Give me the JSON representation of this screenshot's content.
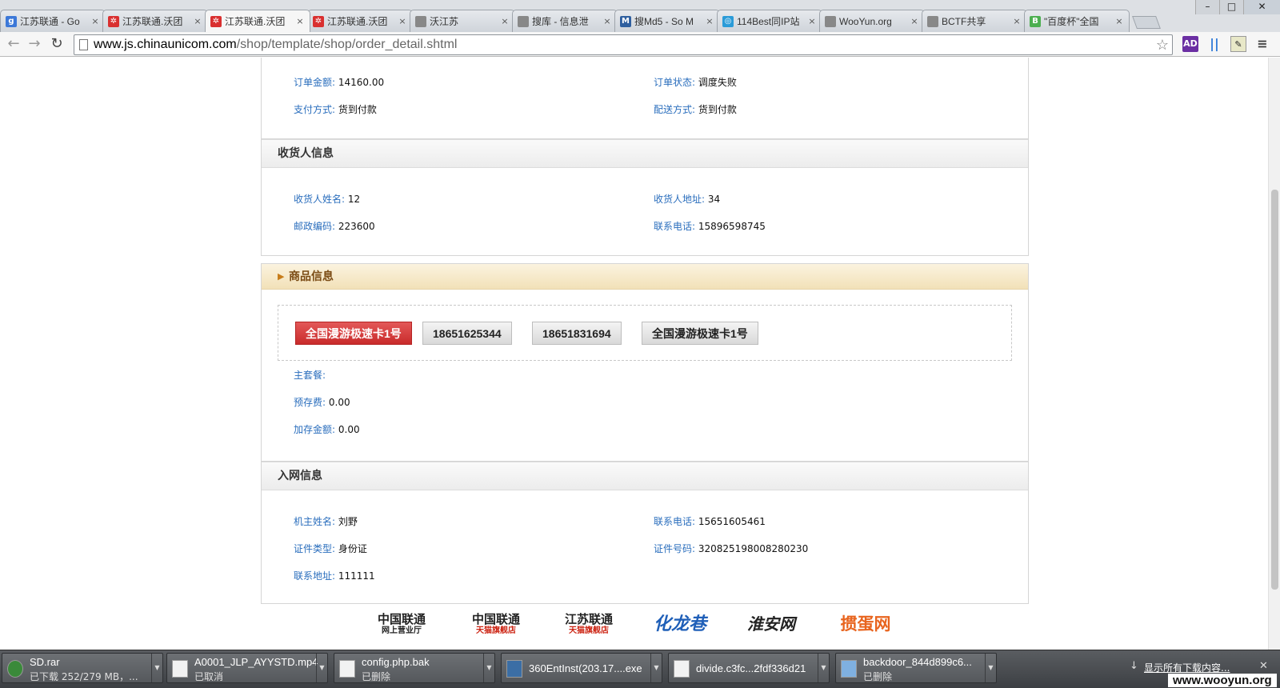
{
  "browser": {
    "tabs": [
      {
        "title": "江苏联通 - Go",
        "favicon_color": "#3c78d8",
        "favicon_glyph": "g",
        "active": false
      },
      {
        "title": "江苏联通.沃团",
        "favicon_color": "#d93030",
        "favicon_glyph": "✲",
        "active": false
      },
      {
        "title": "江苏联通.沃团",
        "favicon_color": "#d93030",
        "favicon_glyph": "✲",
        "active": true
      },
      {
        "title": "江苏联通.沃团",
        "favicon_color": "#d93030",
        "favicon_glyph": "✲",
        "active": false
      },
      {
        "title": "沃江苏",
        "favicon_color": "#888888",
        "favicon_glyph": "",
        "active": false
      },
      {
        "title": "搜库 - 信息泄",
        "favicon_color": "#888888",
        "favicon_glyph": "",
        "active": false
      },
      {
        "title": "搜Md5 - So M",
        "favicon_color": "#2f5f9f",
        "favicon_glyph": "M",
        "active": false
      },
      {
        "title": "114Best同IP站",
        "favicon_color": "#2a9bd8",
        "favicon_glyph": "◎",
        "active": false
      },
      {
        "title": "WooYun.org",
        "favicon_color": "#888888",
        "favicon_glyph": "",
        "active": false
      },
      {
        "title": "BCTF共享",
        "favicon_color": "#888888",
        "favicon_glyph": "",
        "active": false
      },
      {
        "title": "\"百度杯\"全国",
        "favicon_color": "#4caf50",
        "favicon_glyph": "B",
        "active": false
      }
    ],
    "url_domain": "www.js.chinaunicom.com",
    "url_path": "/shop/template/shop/order_detail.shtml",
    "ext_ad": "AD",
    "window_controls": {
      "minimize": "–",
      "maximize": "□",
      "close": "✕"
    }
  },
  "order": {
    "amount_label": "订单金额:",
    "amount_value": "14160.00",
    "status_label": "订单状态:",
    "status_value": "调度失败",
    "payment_label": "支付方式:",
    "payment_value": "货到付款",
    "delivery_label": "配送方式:",
    "delivery_value": "货到付款"
  },
  "receiver": {
    "heading": "收货人信息",
    "name_label": "收货人姓名:",
    "name_value": "12",
    "address_label": "收货人地址:",
    "address_value": "34",
    "zip_label": "邮政编码:",
    "zip_value": "223600",
    "phone_label": "联系电话:",
    "phone_value": "15896598745"
  },
  "goods": {
    "heading": "商品信息",
    "tags": [
      "全国漫游极速卡1号",
      "18651625344",
      "18651831694",
      "全国漫游极速卡1号"
    ],
    "main_plan_label": "主套餐:",
    "main_plan_value": "",
    "prestore_label": "预存费:",
    "prestore_value": "0.00",
    "extra_label": "加存金额:",
    "extra_value": "0.00"
  },
  "network": {
    "heading": "入网信息",
    "owner_label": "机主姓名:",
    "owner_value": "刘野",
    "phone_label": "联系电话:",
    "phone_value": "15651605461",
    "idtype_label": "证件类型:",
    "idtype_value": "身份证",
    "idno_label": "证件号码:",
    "idno_value": "320825198008280230",
    "address_label": "联系地址:",
    "address_value": "111111"
  },
  "footer_logos": [
    {
      "line1": "中国联通",
      "line2": "网上营业厅",
      "color": "#222222"
    },
    {
      "line1": "中国联通",
      "line2": "天猫旗舰店",
      "color": "#222222"
    },
    {
      "line1": "江苏联通",
      "line2": "天猫旗舰店",
      "color": "#222222"
    },
    {
      "line1": "化龙巷",
      "line2": "",
      "color": "#1f5fb8"
    },
    {
      "line1": "淮安网",
      "line2": "",
      "color": "#222222"
    },
    {
      "line1": "掼蛋网",
      "line2": "",
      "color": "#e8641e"
    }
  ],
  "downloads": {
    "items": [
      {
        "name": "SD.rar",
        "status": "已下载 252/279 MB，...",
        "type": "rar"
      },
      {
        "name": "A0001_JLP_AYYSTD.mp4",
        "status": "已取消",
        "type": "doc"
      },
      {
        "name": "config.php.bak",
        "status": "已删除",
        "type": "doc"
      },
      {
        "name": "360EntInst(203.17....exe",
        "status": "",
        "type": "exe"
      },
      {
        "name": "divide.c3fc...2fdf336d21",
        "status": "",
        "type": "doc"
      },
      {
        "name": "backdoor_844d899c6...",
        "status": "已删除",
        "type": "img"
      }
    ],
    "show_all": "显示所有下载内容...",
    "close": "✕"
  },
  "watermark": "www.wooyun.org"
}
